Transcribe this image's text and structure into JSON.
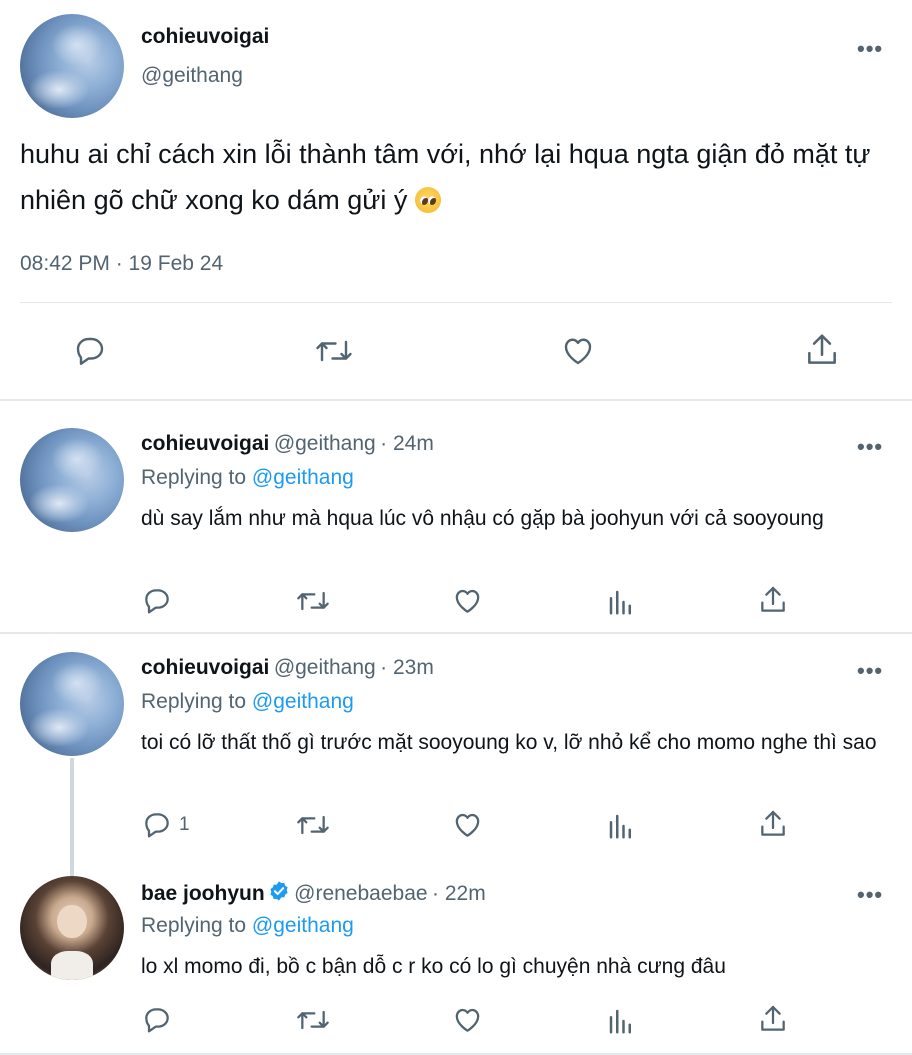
{
  "main": {
    "display_name": "cohieuvoigai",
    "handle": "@geithang",
    "text": "huhu ai chỉ cách xin lỗi thành tâm với, nhớ lại hqua ngta giận đỏ mặt tự nhiên gõ chữ xong ko dám gửi ý",
    "emoji_icon": "pleading-face-emoji",
    "timestamp": "08:42 PM · 19 Feb 24",
    "actions": [
      "reply-icon",
      "retweet-icon",
      "like-icon",
      "share-icon"
    ]
  },
  "replies": [
    {
      "display_name": "cohieuvoigai",
      "handle": "@geithang",
      "time": "· 24m",
      "replying_label": "Replying to",
      "replying_to": "@geithang",
      "text": "dù say lắm như mà hqua lúc vô nhậu có gặp bà joohyun với cả sooyoung",
      "reply_count": ""
    },
    {
      "display_name": "cohieuvoigai",
      "handle": "@geithang",
      "time": "· 23m",
      "replying_label": "Replying to",
      "replying_to": "@geithang",
      "text": "toi có lỡ thất thố gì trước mặt sooyoung ko v, lỡ nhỏ kể cho momo nghe thì sao",
      "reply_count": "1"
    },
    {
      "display_name": "bae joohyun",
      "verified": true,
      "handle": "@renebaebae",
      "time": "· 22m",
      "replying_label": "Replying to",
      "replying_to": "@geithang",
      "text": "lo xl momo đi, bồ c bận dỗ c r ko có lo gì chuyện nhà cưng đâu",
      "reply_count": ""
    }
  ],
  "colors": {
    "link": "#1d9bf0",
    "secondary": "#536471",
    "text": "#0f1419",
    "divider": "#e6e9ec"
  }
}
